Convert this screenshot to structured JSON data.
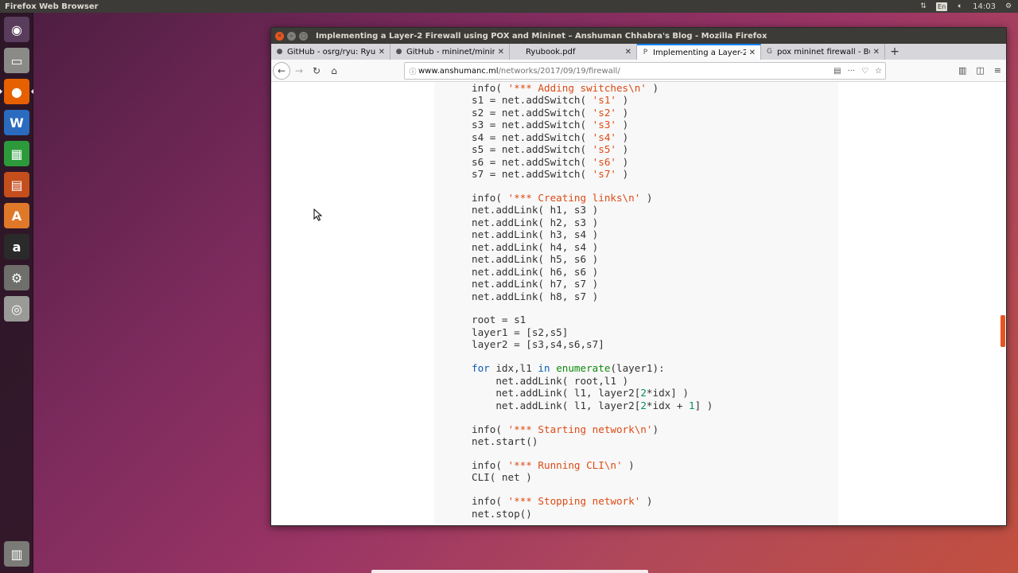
{
  "top_panel": {
    "app_title": "Firefox Web Browser",
    "lang": "En",
    "clock": "14:03"
  },
  "launcher": {
    "items": [
      {
        "name": "dash-home",
        "glyph": "◉",
        "color": "#5a3d5c"
      },
      {
        "name": "files",
        "glyph": "▭",
        "color": "#8a8a86"
      },
      {
        "name": "firefox",
        "glyph": "●",
        "color": "#e66000"
      },
      {
        "name": "writer",
        "glyph": "W",
        "color": "#2a6bbf"
      },
      {
        "name": "calc",
        "glyph": "▦",
        "color": "#2c9a3a"
      },
      {
        "name": "impress",
        "glyph": "▤",
        "color": "#c54e1d"
      },
      {
        "name": "software-center",
        "glyph": "A",
        "color": "#e0782a"
      },
      {
        "name": "amazon",
        "glyph": "a",
        "color": "#2a2a2a"
      },
      {
        "name": "system-settings",
        "glyph": "⚙",
        "color": "#6e6e6a"
      },
      {
        "name": "dvd",
        "glyph": "◎",
        "color": "#9a9a96"
      },
      {
        "name": "trash",
        "glyph": "▥",
        "color": "#7a7a76"
      }
    ]
  },
  "window": {
    "title": "Implementing a Layer-2 Firewall using POX and Mininet – Anshuman Chhabra's Blog - Mozilla Firefox"
  },
  "tabs": [
    {
      "label": "GitHub - osrg/ryu: Ryu c",
      "icon": "●",
      "active": false
    },
    {
      "label": "GitHub - mininet/minine",
      "icon": "●",
      "active": false
    },
    {
      "label": "Ryubook.pdf",
      "icon": "",
      "active": false
    },
    {
      "label": "Implementing a Layer-2",
      "icon": "P",
      "active": true
    },
    {
      "label": "pox mininet firewall - Bu",
      "icon": "G",
      "active": false
    }
  ],
  "navbar": {
    "url_host": "www.anshumanc.ml",
    "url_path": "/networks/2017/09/19/firewall/"
  },
  "code_lines": [
    [
      [
        "",
        "info( "
      ],
      [
        "s",
        "'*** Adding switches\\n'"
      ],
      [
        "",
        " )"
      ]
    ],
    [
      [
        "",
        "s1 = net.addSwitch( "
      ],
      [
        "s",
        "'s1'"
      ],
      [
        "",
        " )"
      ]
    ],
    [
      [
        "",
        "s2 = net.addSwitch( "
      ],
      [
        "s",
        "'s2'"
      ],
      [
        "",
        " )"
      ]
    ],
    [
      [
        "",
        "s3 = net.addSwitch( "
      ],
      [
        "s",
        "'s3'"
      ],
      [
        "",
        " )"
      ]
    ],
    [
      [
        "",
        "s4 = net.addSwitch( "
      ],
      [
        "s",
        "'s4'"
      ],
      [
        "",
        " )"
      ]
    ],
    [
      [
        "",
        "s5 = net.addSwitch( "
      ],
      [
        "s",
        "'s5'"
      ],
      [
        "",
        " )"
      ]
    ],
    [
      [
        "",
        "s6 = net.addSwitch( "
      ],
      [
        "s",
        "'s6'"
      ],
      [
        "",
        " )"
      ]
    ],
    [
      [
        "",
        "s7 = net.addSwitch( "
      ],
      [
        "s",
        "'s7'"
      ],
      [
        "",
        " )"
      ]
    ],
    null,
    [
      [
        "",
        "info( "
      ],
      [
        "s",
        "'*** Creating links\\n'"
      ],
      [
        "",
        " )"
      ]
    ],
    [
      [
        "",
        "net.addLink( h1, s3 )"
      ]
    ],
    [
      [
        "",
        "net.addLink( h2, s3 )"
      ]
    ],
    [
      [
        "",
        "net.addLink( h3, s4 )"
      ]
    ],
    [
      [
        "",
        "net.addLink( h4, s4 )"
      ]
    ],
    [
      [
        "",
        "net.addLink( h5, s6 )"
      ]
    ],
    [
      [
        "",
        "net.addLink( h6, s6 )"
      ]
    ],
    [
      [
        "",
        "net.addLink( h7, s7 )"
      ]
    ],
    [
      [
        "",
        "net.addLink( h8, s7 )"
      ]
    ],
    null,
    [
      [
        "",
        "root = s1"
      ]
    ],
    [
      [
        "",
        "layer1 = [s2,s5]"
      ]
    ],
    [
      [
        "",
        "layer2 = [s3,s4,s6,s7]"
      ]
    ],
    null,
    [
      [
        "k",
        "for"
      ],
      [
        "",
        " idx,l1 "
      ],
      [
        "k",
        "in"
      ],
      [
        "",
        " "
      ],
      [
        "bi",
        "enumerate"
      ],
      [
        "",
        "(layer1):"
      ]
    ],
    [
      [
        "",
        "    net.addLink( root,l1 )"
      ]
    ],
    [
      [
        "",
        "    net.addLink( l1, layer2["
      ],
      [
        "n",
        "2"
      ],
      [
        "",
        "*idx] )"
      ]
    ],
    [
      [
        "",
        "    net.addLink( l1, layer2["
      ],
      [
        "n",
        "2"
      ],
      [
        "",
        "*idx + "
      ],
      [
        "n",
        "1"
      ],
      [
        "",
        "] )"
      ]
    ],
    null,
    [
      [
        "",
        "info( "
      ],
      [
        "s",
        "'*** Starting network\\n'"
      ],
      [
        "",
        ")"
      ]
    ],
    [
      [
        "",
        "net.start()"
      ]
    ],
    null,
    [
      [
        "",
        "info( "
      ],
      [
        "s",
        "'*** Running CLI\\n'"
      ],
      [
        "",
        " )"
      ]
    ],
    [
      [
        "",
        "CLI( net )"
      ]
    ],
    null,
    [
      [
        "",
        "info( "
      ],
      [
        "s",
        "'*** Stopping network'"
      ],
      [
        "",
        " )"
      ]
    ],
    [
      [
        "",
        "net.stop()"
      ]
    ]
  ]
}
